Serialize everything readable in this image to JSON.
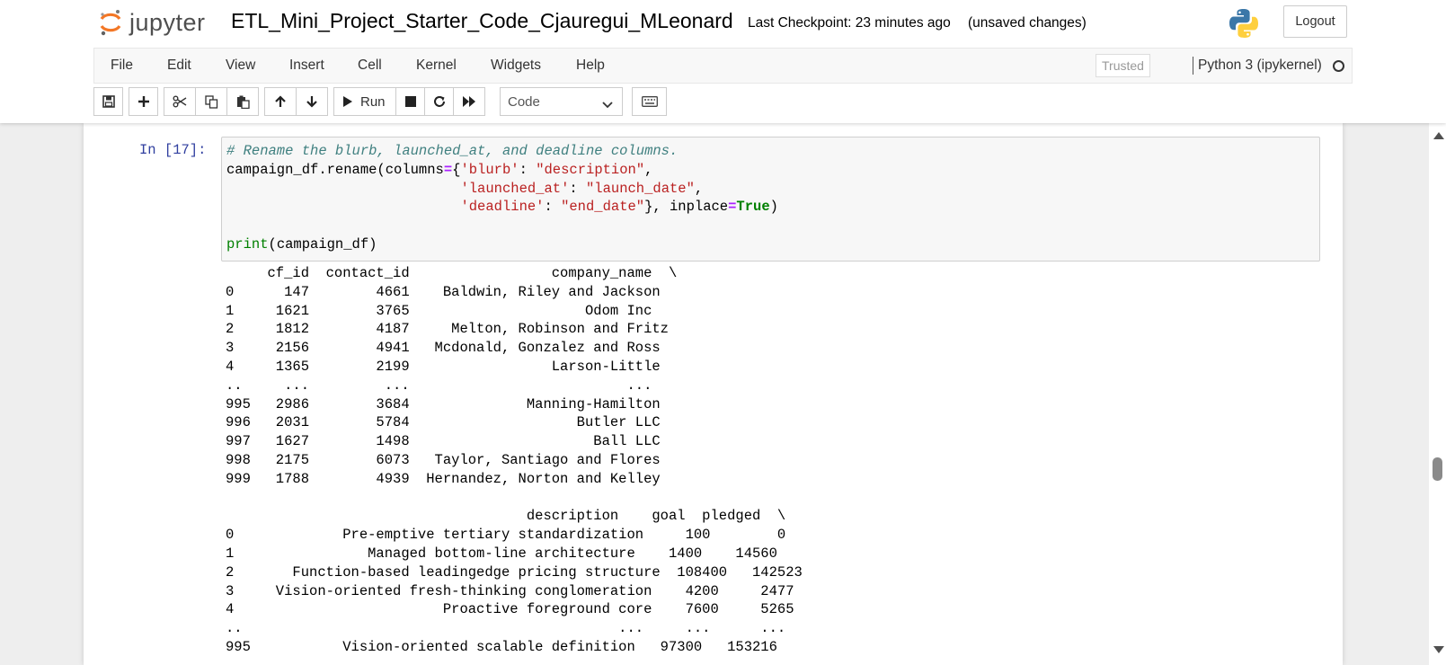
{
  "header": {
    "logo_text": "jupyter",
    "notebook_title": "ETL_Mini_Project_Starter_Code_Cjauregui_MLeonard",
    "checkpoint": "Last Checkpoint: 23 minutes ago",
    "autosave_status": "(unsaved changes)",
    "logout_label": "Logout"
  },
  "menubar": {
    "items": [
      "File",
      "Edit",
      "View",
      "Insert",
      "Cell",
      "Kernel",
      "Widgets",
      "Help"
    ],
    "trusted_label": "Trusted",
    "kernel_name": "Python 3 (ipykernel)"
  },
  "toolbar": {
    "buttons": [
      "save-icon",
      "plus-icon",
      "cut-icon",
      "copy-icon",
      "paste-icon",
      "arrow-up-icon",
      "arrow-down-icon",
      "run-icon",
      "stop-icon",
      "restart-icon",
      "fast-forward-icon",
      "keyboard-icon"
    ],
    "run_label": "Run",
    "cell_type": "Code"
  },
  "cell": {
    "prompt": "In [17]:",
    "code_lines": [
      "# Rename the blurb, launched_at, and deadline columns.",
      "campaign_df.rename(columns={'blurb': \"description\",",
      "                            'launched_at': \"launch_date\",",
      "                            'deadline': \"end_date\"}, inplace=True)",
      "",
      "print(campaign_df)"
    ],
    "output_lines": [
      "     cf_id  contact_id                 company_name  \\",
      "0      147        4661    Baldwin, Riley and Jackson   ",
      "1     1621        3765                     Odom Inc   ",
      "2     1812        4187     Melton, Robinson and Fritz   ",
      "3     2156        4941   Mcdonald, Gonzalez and Ross   ",
      "4     1365        2199                 Larson-Little   ",
      "..     ...         ...                          ...   ",
      "995   2986        3684              Manning-Hamilton   ",
      "996   2031        5784                    Butler LLC   ",
      "997   1627        1498                      Ball LLC   ",
      "998   2175        6073   Taylor, Santiago and Flores   ",
      "999   1788        4939  Hernandez, Norton and Kelley   ",
      "",
      "                                    description    goal  pledged  \\",
      "0             Pre-emptive tertiary standardization     100        0   ",
      "1                Managed bottom-line architecture    1400    14560   ",
      "2       Function-based leadingedge pricing structure  108400   142523   ",
      "3     Vision-oriented fresh-thinking conglomeration    4200     2477   ",
      "4                         Proactive foreground core    7600     5265   ",
      "..                                             ...     ...      ...   ",
      "995           Vision-oriented scalable definition   97300   153216   "
    ]
  }
}
